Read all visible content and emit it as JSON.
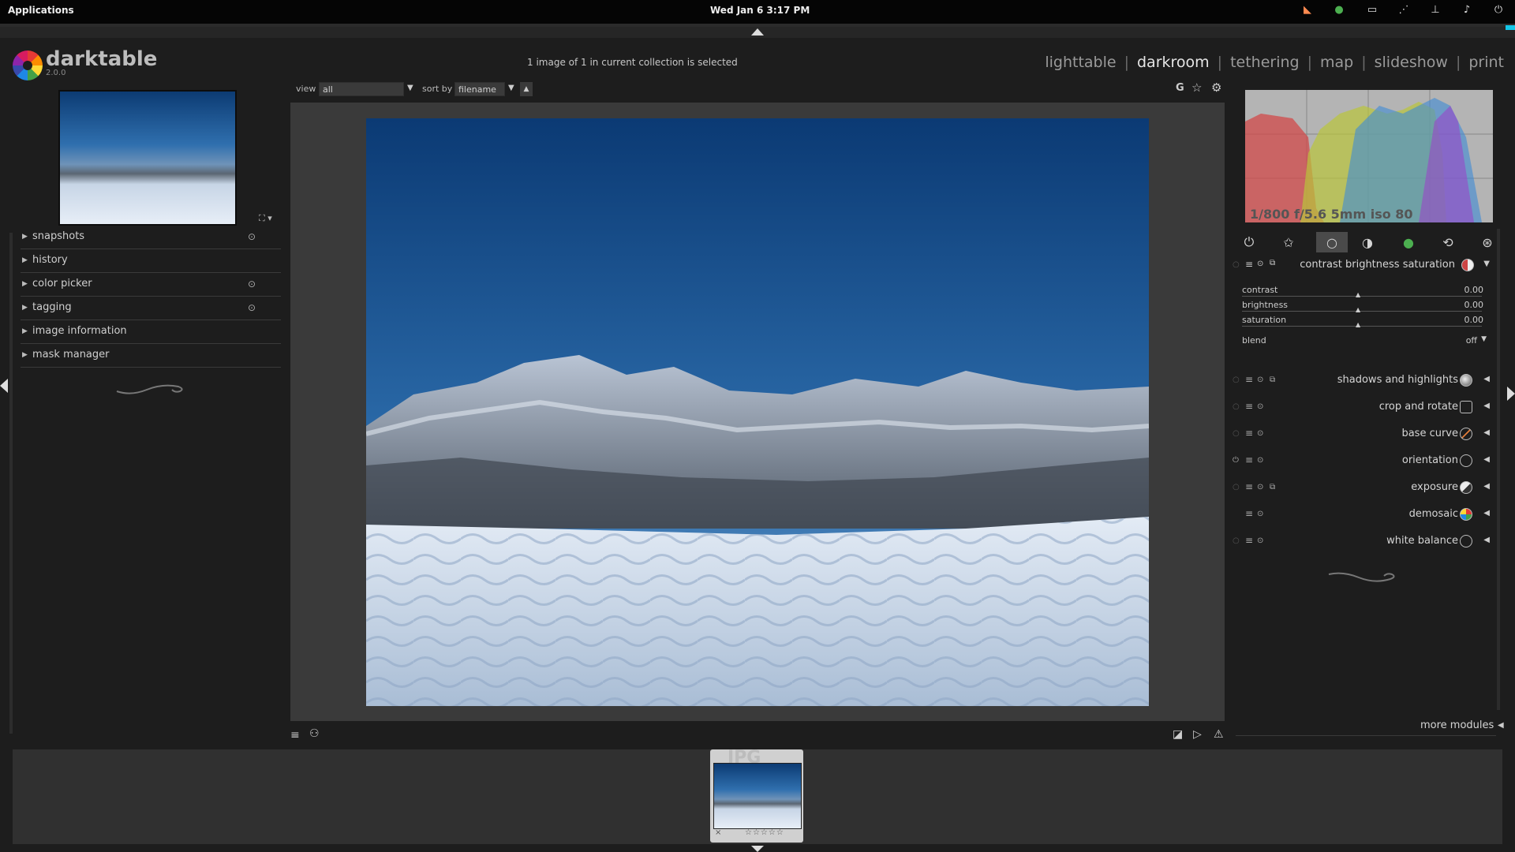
{
  "system": {
    "applications": "Applications",
    "clock": "Wed Jan  6   3:17 PM"
  },
  "header": {
    "app_name": "darktable",
    "version": "2.0.0",
    "collection_info": "1 image of 1 in current collection is selected",
    "views": [
      "lighttable",
      "darkroom",
      "tethering",
      "map",
      "slideshow",
      "print"
    ],
    "active_view": "darkroom"
  },
  "left_panel": {
    "modules": [
      {
        "label": "snapshots",
        "pinned": true
      },
      {
        "label": "history",
        "pinned": false
      },
      {
        "label": "color picker",
        "pinned": true
      },
      {
        "label": "tagging",
        "pinned": true
      },
      {
        "label": "image information",
        "pinned": false
      },
      {
        "label": "mask manager",
        "pinned": false
      }
    ]
  },
  "center_toolbar": {
    "view_label": "view",
    "view_value": "all",
    "sort_label": "sort by",
    "sort_value": "filename",
    "grouping_label": "G"
  },
  "right_panel": {
    "exif": "1/800 f/5.6 5mm iso 80",
    "groups": [
      "power-icon",
      "star-icon",
      "circle-icon",
      "tone-icon",
      "color-icon",
      "correct-icon",
      "effect-icon"
    ],
    "active_group": 2,
    "expanded_module": {
      "title": "contrast brightness saturation",
      "sliders": [
        {
          "label": "contrast",
          "value": "0.00"
        },
        {
          "label": "brightness",
          "value": "0.00"
        },
        {
          "label": "saturation",
          "value": "0.00"
        }
      ],
      "blend_label": "blend",
      "blend_value": "off"
    },
    "modules": [
      "shadows and highlights",
      "crop and rotate",
      "base curve",
      "orientation",
      "exposure",
      "demosaic",
      "white balance"
    ],
    "more_modules": "more modules"
  },
  "filmstrip": {
    "format_label": "JPG",
    "rating_stars": 5,
    "reject_mark": "×"
  },
  "colors": {
    "background": "#1d1d1d",
    "panel_text": "#c8c8c8",
    "image_frame": "#3a3a3a",
    "sky_top": "#0c3b73",
    "sky_bottom": "#6f93b8"
  }
}
